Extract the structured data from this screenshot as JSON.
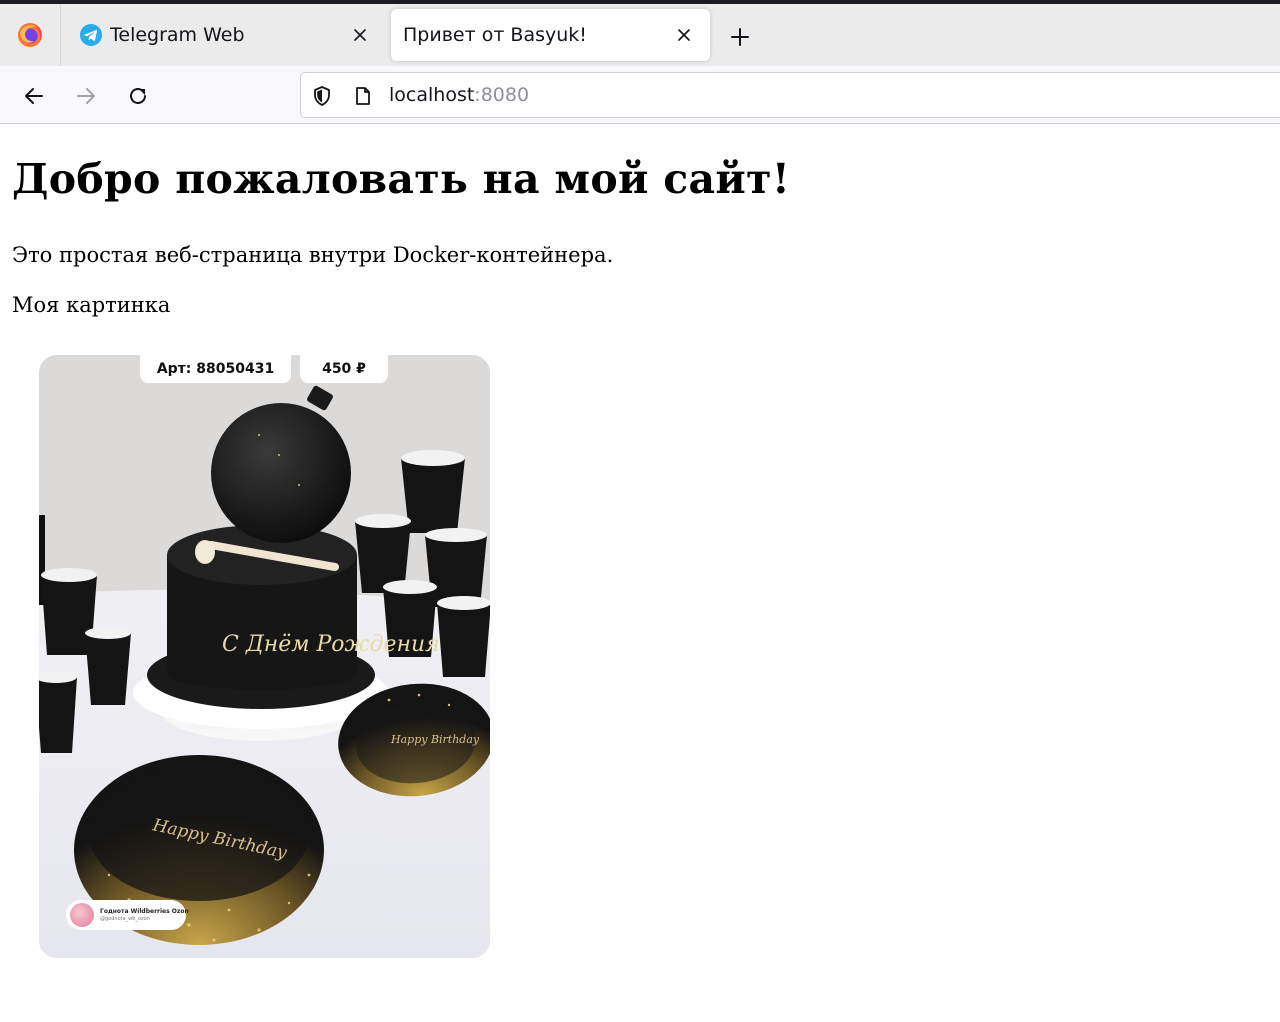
{
  "browser": {
    "tabs": [
      {
        "title": "Telegram Web",
        "favicon": "telegram-icon",
        "active": false
      },
      {
        "title": "Привет от Basyuk!",
        "favicon": null,
        "active": true
      }
    ],
    "url": {
      "host": "localhost",
      "port": ":8080"
    },
    "icons": {
      "logo": "firefox-icon",
      "close": "close-icon",
      "new_tab": "plus-icon",
      "back": "arrow-left-icon",
      "forward": "arrow-right-icon",
      "reload": "reload-icon",
      "security": "shield-icon",
      "page": "page-icon"
    },
    "colors": {
      "tabstrip": "#ebebeb",
      "navbar": "#f9f9fb",
      "active_tab": "#ffffff",
      "text": "#15141a"
    }
  },
  "page": {
    "heading": "Добро пожаловать на мой сайт!",
    "intro": "Это простая веб-страница внутри Docker-контейнера.",
    "image_caption": "Моя картинка",
    "image": {
      "article_label": "Арт: 88050431",
      "price_label": "450 ₽",
      "cake_text": "С Днём Рождения",
      "plate_text": "Happy Birthday",
      "badge_name": "Годнота Wildberries Ozon",
      "badge_handle": "@godnota_wb_ozon"
    }
  }
}
